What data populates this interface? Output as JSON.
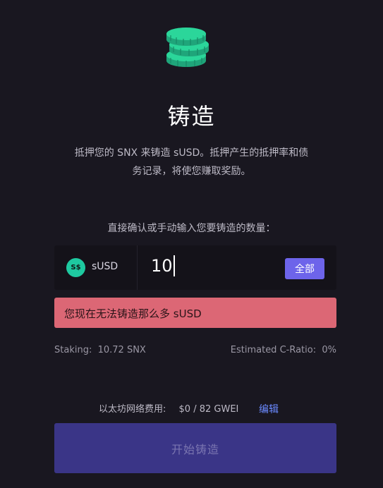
{
  "header": {
    "icon": "coins-stack-icon",
    "title": "铸造",
    "description_line1": "抵押您的 SNX 来铸造 sUSD。抵押产生的抵押率和债",
    "description_line2": "务记录，将使您赚取奖励。"
  },
  "form": {
    "instruction": "直接确认或手动输入您要铸造的数量：",
    "currency": {
      "icon": "susd-token-icon",
      "icon_text": "S$",
      "label": "sUSD"
    },
    "amount_value": "10",
    "max_button_label": "全部",
    "error_message": "您现在无法铸造那么多 sUSD"
  },
  "stats": {
    "staking_label": "Staking:",
    "staking_value": "10.72 SNX",
    "cratio_label": "Estimated C-Ratio:",
    "cratio_value": "0%"
  },
  "fee": {
    "label": "以太坊网络费用:",
    "value": "$0 / 82 GWEI",
    "edit_label": "编辑"
  },
  "action": {
    "submit_label": "开始铸造"
  },
  "colors": {
    "background": "#191720",
    "accent": "#6d64ea",
    "coin": "#2bd69a",
    "error": "#dc6775",
    "primary_button": "#3a3587",
    "link": "#6b8aff"
  }
}
